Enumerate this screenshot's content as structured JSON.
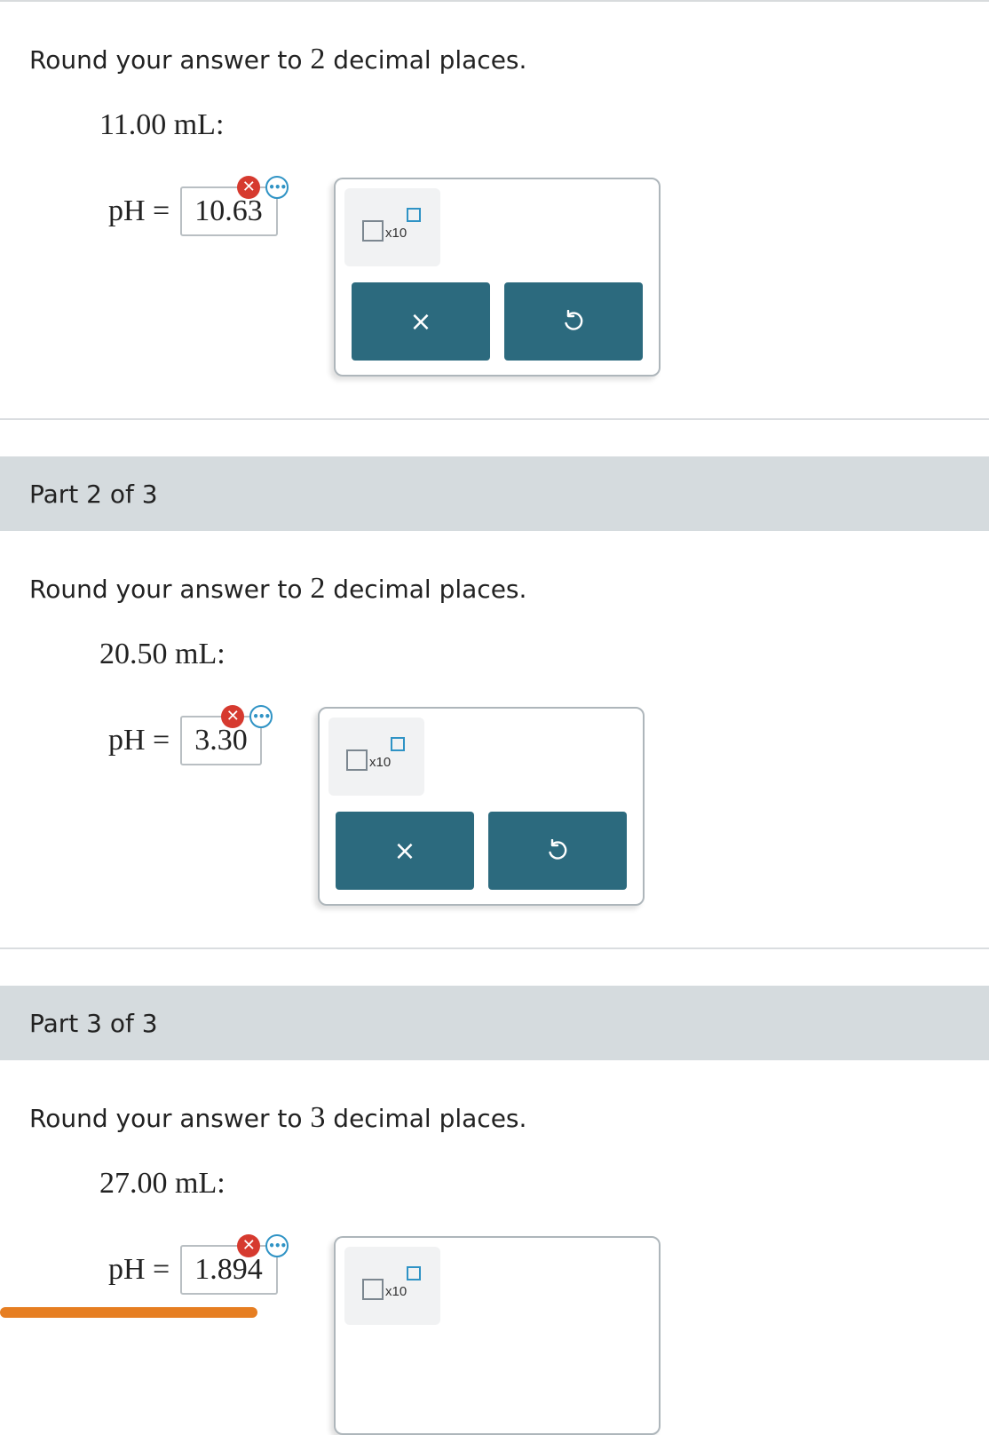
{
  "part1": {
    "instruction_prefix": "Round your answer to ",
    "decimal_count": "2",
    "instruction_suffix": " decimal places.",
    "volume": "11.00 mL:",
    "ph_label": "pH =",
    "answer": "10.63",
    "status": "incorrect"
  },
  "part2": {
    "header": "Part 2 of 3",
    "instruction_prefix": "Round your answer to ",
    "decimal_count": "2",
    "instruction_suffix": " decimal places.",
    "volume": "20.50 mL:",
    "ph_label": "pH =",
    "answer": "3.30",
    "status": "incorrect"
  },
  "part3": {
    "header": "Part 3 of 3",
    "instruction_prefix": "Round your answer to ",
    "decimal_count": "3",
    "instruction_suffix": " decimal places.",
    "volume": "27.00 mL:",
    "ph_label": "pH =",
    "answer": "1.894",
    "status": "incorrect"
  },
  "panel": {
    "x10_label": "x10",
    "clear_icon": "×"
  },
  "colors": {
    "button": "#2c6a7e",
    "part_bar": "#d5dbde",
    "error": "#d63a2f",
    "accent": "#2f93c5"
  }
}
